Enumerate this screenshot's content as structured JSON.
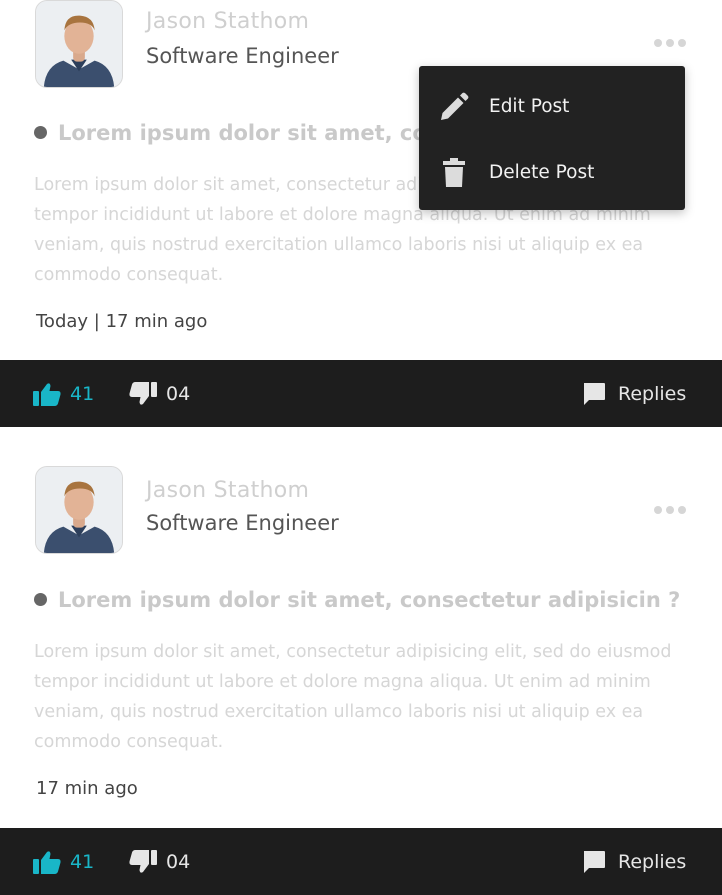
{
  "posts": [
    {
      "author": "Jason Stathom",
      "role": "Software Engineer",
      "title": "Lorem ipsum dolor sit amet, consectetur adipisicin ?",
      "body": "Lorem ipsum dolor sit amet, consectetur adipisicing elit, sed do eiusmod tempor incididunt ut labore et dolore magna aliqua. Ut enim ad minim veniam, quis nostrud exercitation ullamco laboris nisi ut aliquip ex ea commodo consequat.",
      "time": "Today | 17 min ago",
      "likes": "41",
      "dislikes": "04",
      "replies_label": "Replies"
    },
    {
      "author": "Jason Stathom",
      "role": "Software Engineer",
      "title": "Lorem ipsum dolor sit amet, consectetur adipisicin ?",
      "body": "Lorem ipsum dolor sit amet, consectetur adipisicing elit, sed do eiusmod tempor incididunt ut labore et dolore magna aliqua. Ut enim ad minim veniam, quis nostrud exercitation ullamco laboris nisi ut aliquip ex ea commodo consequat.",
      "time": "17 min ago",
      "likes": "41",
      "dislikes": "04",
      "replies_label": "Replies"
    }
  ],
  "dropdown": {
    "items": [
      {
        "label": "Edit Post",
        "icon": "pencil-icon"
      },
      {
        "label": "Delete Post",
        "icon": "trash-icon"
      }
    ]
  },
  "colors": {
    "action_bar_bg": "#1d1d1d",
    "like_accent": "#19b6c8",
    "menu_bg": "#222222"
  }
}
